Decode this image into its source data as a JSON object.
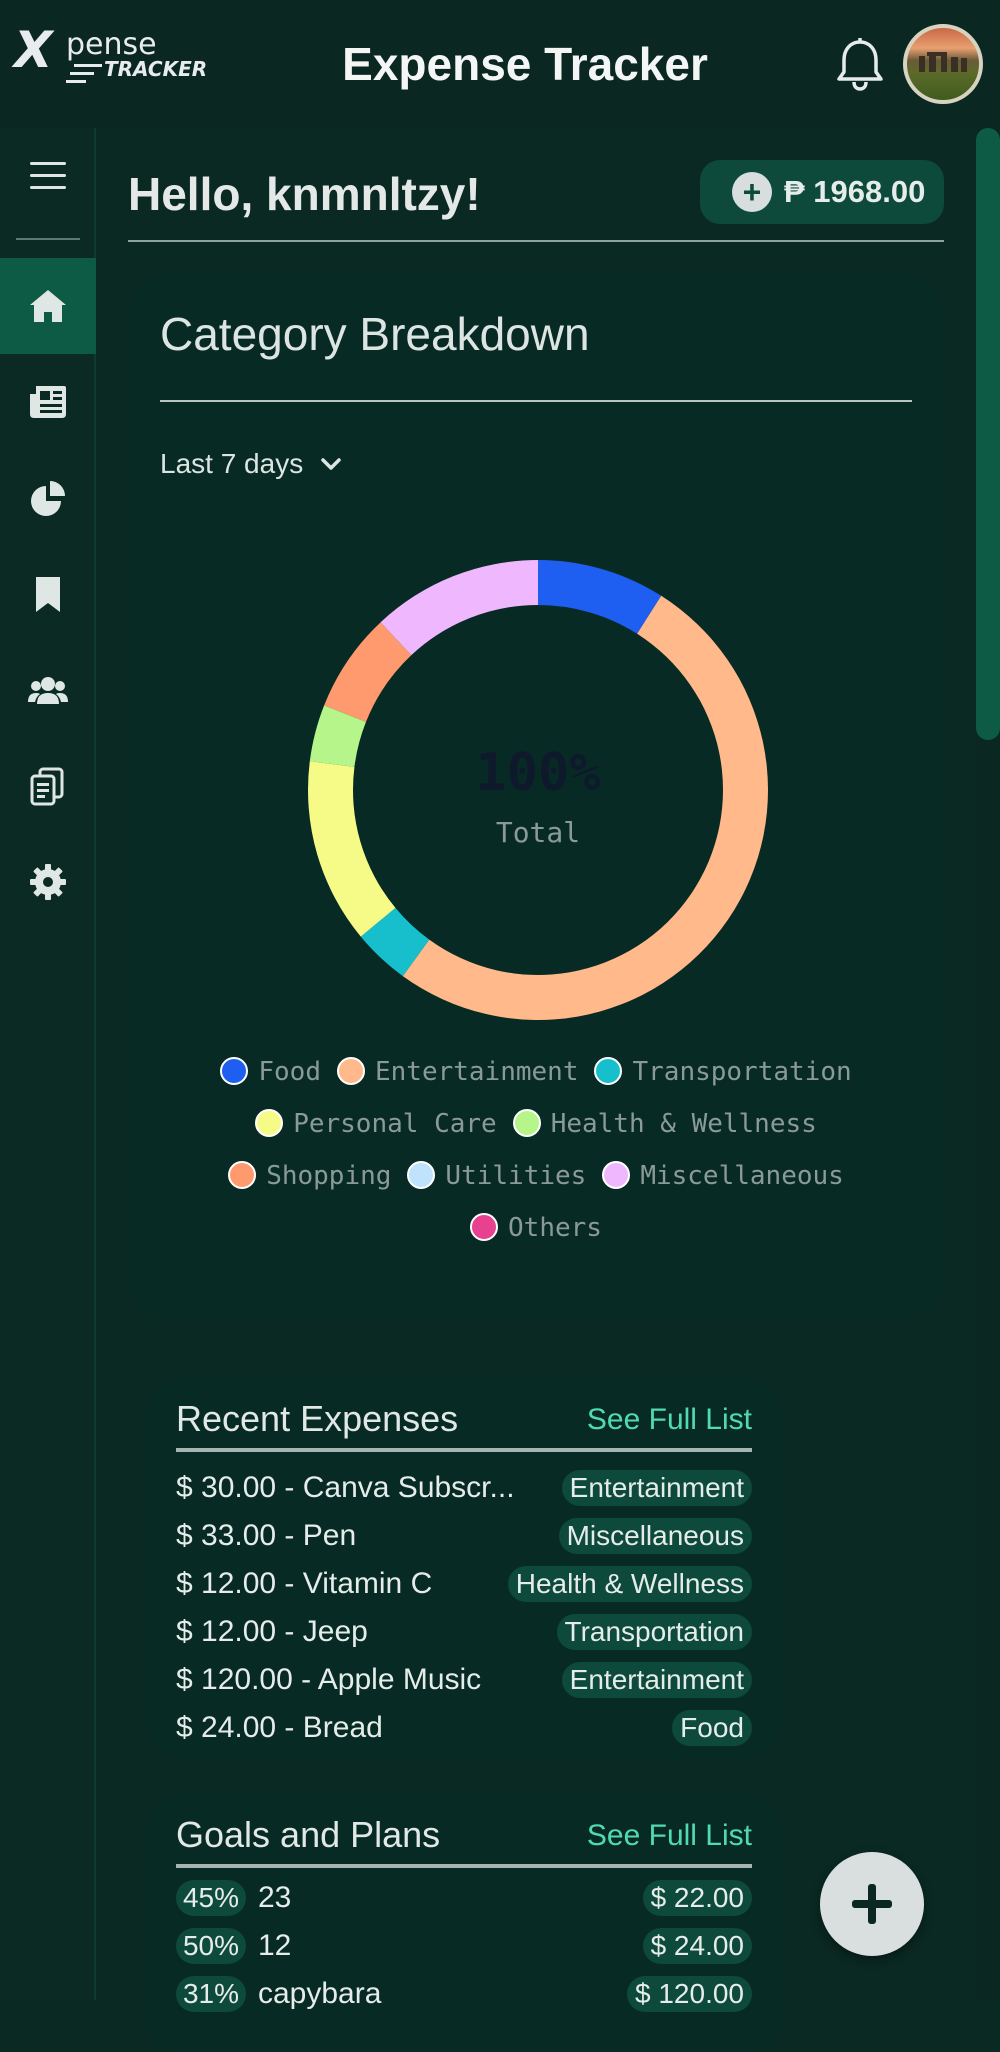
{
  "header": {
    "logo_x": "X",
    "logo_pense": "pense",
    "logo_tracker": "TRACKER",
    "title": "Expense Tracker",
    "bell_icon": "bell-icon",
    "avatar_alt": "user-avatar"
  },
  "sidebar": {
    "items": [
      {
        "icon": "home-icon",
        "active": true
      },
      {
        "icon": "newspaper-icon",
        "active": false
      },
      {
        "icon": "pie-chart-icon",
        "active": false
      },
      {
        "icon": "bookmark-icon",
        "active": false
      },
      {
        "icon": "users-icon",
        "active": false
      },
      {
        "icon": "clipboard-icon",
        "active": false
      },
      {
        "icon": "gear-icon",
        "active": false
      }
    ]
  },
  "greeting": "Hello, knmnltzy!",
  "balance": {
    "plus": "+",
    "amount": "₱ 1968.00"
  },
  "category": {
    "title": "Category Breakdown",
    "range": "Last 7 days",
    "center_value": "100%",
    "center_label": "Total",
    "legend_rows": [
      [
        0,
        1,
        2
      ],
      [
        3,
        4
      ],
      [
        5,
        6,
        7
      ],
      [
        8
      ]
    ]
  },
  "chart_data": {
    "type": "pie",
    "donut": true,
    "categories": [
      "Food",
      "Entertainment",
      "Transportation",
      "Personal Care",
      "Health & Wellness",
      "Shopping",
      "Utilities",
      "Miscellaneous",
      "Others"
    ],
    "values": [
      9,
      51,
      4,
      13,
      4,
      7,
      0,
      12,
      0
    ],
    "colors": [
      "#1e5ef0",
      "#ffb98a",
      "#17bfcc",
      "#f6fb87",
      "#b6f589",
      "#ff9a6e",
      "#bfe2fd",
      "#efb7fd",
      "#e7418f"
    ],
    "legend": "bottom"
  },
  "expenses": {
    "title": "Recent Expenses",
    "link": "See Full List",
    "rows": [
      {
        "text": "$ 30.00 - Canva Subscr...",
        "tag": "Entertainment"
      },
      {
        "text": "$ 33.00 - Pen",
        "tag": "Miscellaneous"
      },
      {
        "text": "$ 12.00 - Vitamin C",
        "tag": "Health & Wellness"
      },
      {
        "text": "$ 12.00 - Jeep",
        "tag": "Transportation"
      },
      {
        "text": "$ 120.00 - Apple Music",
        "tag": "Entertainment"
      },
      {
        "text": "$ 24.00 - Bread",
        "tag": "Food"
      }
    ]
  },
  "goals": {
    "title": "Goals and Plans",
    "link": "See Full List",
    "rows": [
      {
        "pct": "45%",
        "name": "23",
        "amount": "$ 22.00"
      },
      {
        "pct": "50%",
        "name": "12",
        "amount": "$ 24.00"
      },
      {
        "pct": "31%",
        "name": "capybara",
        "amount": "$ 120.00"
      }
    ]
  },
  "fab": {
    "icon": "plus-icon"
  }
}
